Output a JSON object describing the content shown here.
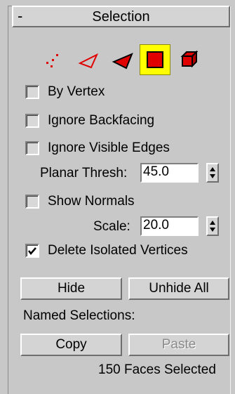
{
  "rollout": {
    "collapse_symbol": "-",
    "title": "Selection"
  },
  "selection_levels": [
    {
      "name": "vertex-icon",
      "active": false
    },
    {
      "name": "edge-icon",
      "active": false
    },
    {
      "name": "face-icon",
      "active": false
    },
    {
      "name": "polygon-icon",
      "active": true
    },
    {
      "name": "element-icon",
      "active": false
    }
  ],
  "options": {
    "by_vertex": {
      "label": "By Vertex",
      "checked": false
    },
    "ignore_backfacing": {
      "label": "Ignore Backfacing",
      "checked": false
    },
    "ignore_visible_edges": {
      "label": "Ignore Visible Edges",
      "checked": false
    },
    "planar_thresh": {
      "label": "Planar Thresh:",
      "value": "45.0"
    },
    "show_normals": {
      "label": "Show Normals",
      "checked": false
    },
    "scale": {
      "label": "Scale:",
      "value": "20.0"
    },
    "delete_isolated": {
      "label": "Delete Isolated Vertices",
      "checked": true
    }
  },
  "buttons": {
    "hide": "Hide",
    "unhide_all": "Unhide All",
    "copy": "Copy",
    "paste": "Paste"
  },
  "named_selections_label": "Named Selections:",
  "status": "150 Faces Selected",
  "colors": {
    "icon_red": "#e00000",
    "active_highlight": "#ffff00"
  }
}
